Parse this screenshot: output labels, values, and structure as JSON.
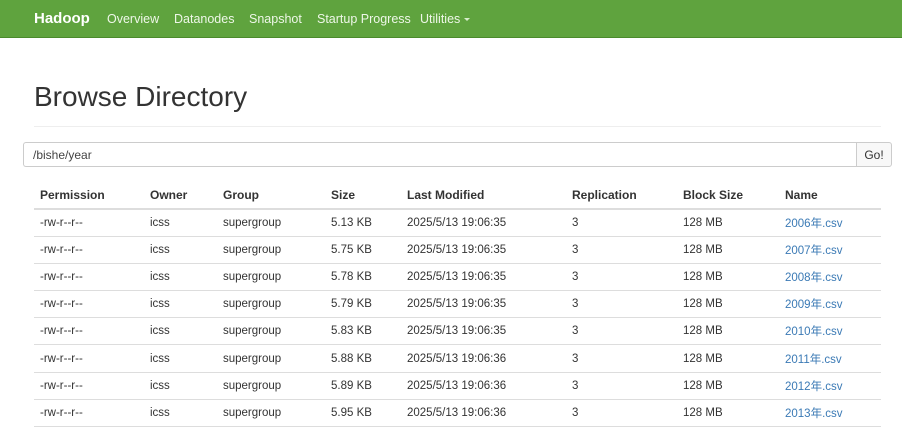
{
  "navbar": {
    "brand": "Hadoop",
    "items": [
      {
        "label": "Overview"
      },
      {
        "label": "Datanodes"
      },
      {
        "label": "Snapshot"
      },
      {
        "label": "Startup Progress"
      },
      {
        "label": "Utilities"
      }
    ]
  },
  "page": {
    "title": "Browse Directory"
  },
  "path_bar": {
    "value": "/bishe/year",
    "go_label": "Go!"
  },
  "table": {
    "headers": [
      "Permission",
      "Owner",
      "Group",
      "Size",
      "Last Modified",
      "Replication",
      "Block Size",
      "Name"
    ],
    "rows": [
      {
        "permission": "-rw-r--r--",
        "owner": "icss",
        "group": "supergroup",
        "size": "5.13 KB",
        "modified": "2025/5/13 19:06:35",
        "replication": "3",
        "block_size": "128 MB",
        "name": "2006年.csv"
      },
      {
        "permission": "-rw-r--r--",
        "owner": "icss",
        "group": "supergroup",
        "size": "5.75 KB",
        "modified": "2025/5/13 19:06:35",
        "replication": "3",
        "block_size": "128 MB",
        "name": "2007年.csv"
      },
      {
        "permission": "-rw-r--r--",
        "owner": "icss",
        "group": "supergroup",
        "size": "5.78 KB",
        "modified": "2025/5/13 19:06:35",
        "replication": "3",
        "block_size": "128 MB",
        "name": "2008年.csv"
      },
      {
        "permission": "-rw-r--r--",
        "owner": "icss",
        "group": "supergroup",
        "size": "5.79 KB",
        "modified": "2025/5/13 19:06:35",
        "replication": "3",
        "block_size": "128 MB",
        "name": "2009年.csv"
      },
      {
        "permission": "-rw-r--r--",
        "owner": "icss",
        "group": "supergroup",
        "size": "5.83 KB",
        "modified": "2025/5/13 19:06:35",
        "replication": "3",
        "block_size": "128 MB",
        "name": "2010年.csv"
      },
      {
        "permission": "-rw-r--r--",
        "owner": "icss",
        "group": "supergroup",
        "size": "5.88 KB",
        "modified": "2025/5/13 19:06:36",
        "replication": "3",
        "block_size": "128 MB",
        "name": "2011年.csv"
      },
      {
        "permission": "-rw-r--r--",
        "owner": "icss",
        "group": "supergroup",
        "size": "5.89 KB",
        "modified": "2025/5/13 19:06:36",
        "replication": "3",
        "block_size": "128 MB",
        "name": "2012年.csv"
      },
      {
        "permission": "-rw-r--r--",
        "owner": "icss",
        "group": "supergroup",
        "size": "5.95 KB",
        "modified": "2025/5/13 19:06:36",
        "replication": "3",
        "block_size": "128 MB",
        "name": "2013年.csv"
      }
    ]
  },
  "colors": {
    "navbar_bg": "#5fa33e",
    "link": "#3b7ab5"
  }
}
